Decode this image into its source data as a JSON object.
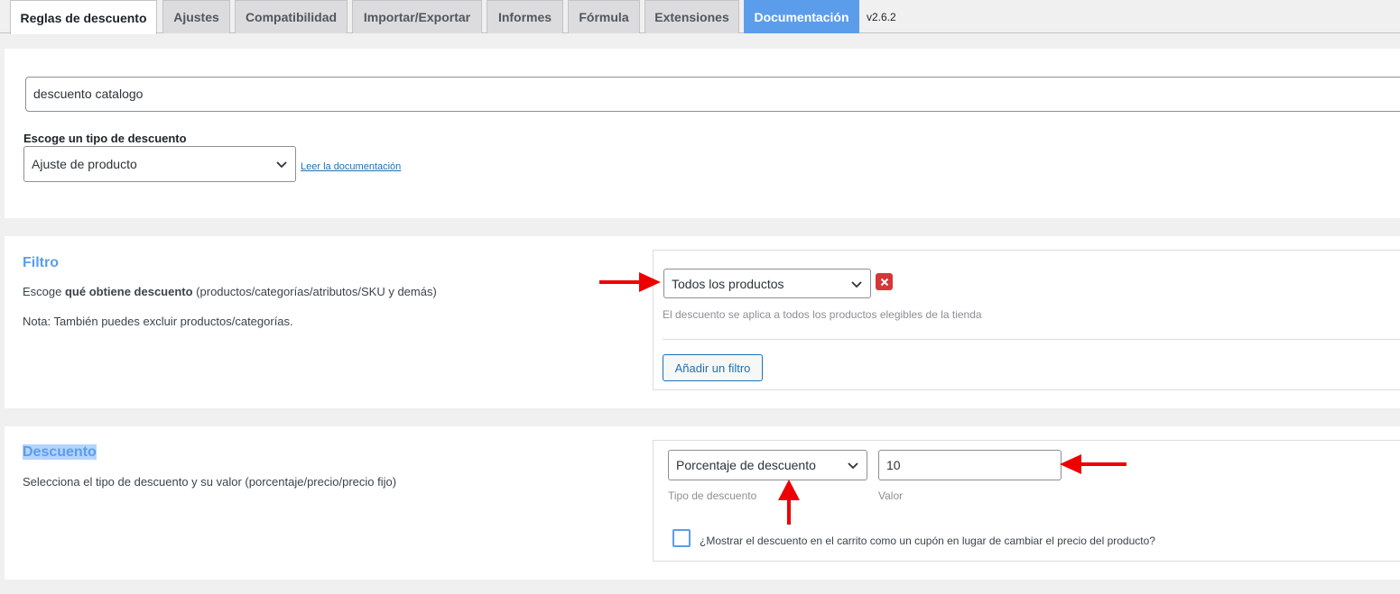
{
  "tabs": [
    {
      "label": "Reglas de descuento",
      "active": true
    },
    {
      "label": "Ajustes"
    },
    {
      "label": "Compatibilidad"
    },
    {
      "label": "Importar/Exportar"
    },
    {
      "label": "Informes"
    },
    {
      "label": "Fórmula"
    },
    {
      "label": "Extensiones"
    },
    {
      "label": "Documentación",
      "highlight": true
    }
  ],
  "version": "v2.6.2",
  "rule": {
    "name_value": "descuento catalogo",
    "discount_type_label": "Escoge un tipo de descuento",
    "discount_type_value": "Ajuste de producto",
    "doc_link": "Leer la documentación"
  },
  "filter": {
    "title": "Filtro",
    "desc_prefix": "Escoge ",
    "desc_bold": "qué obtiene descuento",
    "desc_suffix": " (productos/categorías/atributos/SKU y demás)",
    "note": "Nota: También puedes excluir productos/categorías.",
    "select_value": "Todos los productos",
    "hint": "El descuento se aplica a todos los productos elegibles de la tienda",
    "add_button": "Añadir un filtro"
  },
  "discount": {
    "title": "Descuento",
    "desc": "Selecciona el tipo de descuento y su valor (porcentaje/precio/precio fijo)",
    "type_value": "Porcentaje de descuento",
    "type_hint": "Tipo de descuento",
    "value": "10",
    "value_hint": "Valor",
    "coupon_checkbox_label": "¿Mostrar el descuento en el carrito como un cupón en lugar de cambiar el precio del producto?",
    "coupon_checked": false
  },
  "colors": {
    "accent": "#5b9dea",
    "annotation_arrow": "#ee0000",
    "remove_button": "#d63638"
  }
}
